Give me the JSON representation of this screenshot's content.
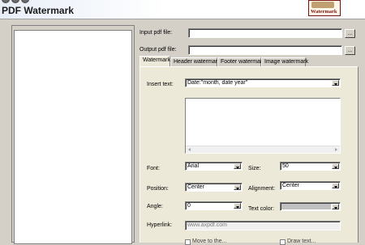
{
  "app": {
    "title": "PDF Watermark",
    "logo_text": "Watermark"
  },
  "files": {
    "input_label": "Input pdf file:",
    "input_value": "",
    "output_label": "Output pdf file:",
    "output_value": "",
    "browse_label": "..."
  },
  "tabs": [
    "Watermark",
    "Header watermark",
    "Footer watermark",
    "Image watermark"
  ],
  "watermark": {
    "insert_text_label": "Insert text:",
    "insert_text_value": "Date:\"month, date year\"",
    "font_label": "Font:",
    "font_value": "Arial",
    "size_label": "Size:",
    "size_value": "50",
    "position_label": "Position:",
    "position_value": "Center",
    "alignment_label": "Alignment:",
    "alignment_value": "Center",
    "angle_label": "Angle:",
    "angle_value": "0",
    "text_color_label": "Text color:",
    "text_color_value": "#c0c0c0",
    "hyperlink_label": "Hyperlink:",
    "hyperlink_value": "www.axpdf.com",
    "option1_label": "Move to the...",
    "option2_label": "Draw text..."
  }
}
